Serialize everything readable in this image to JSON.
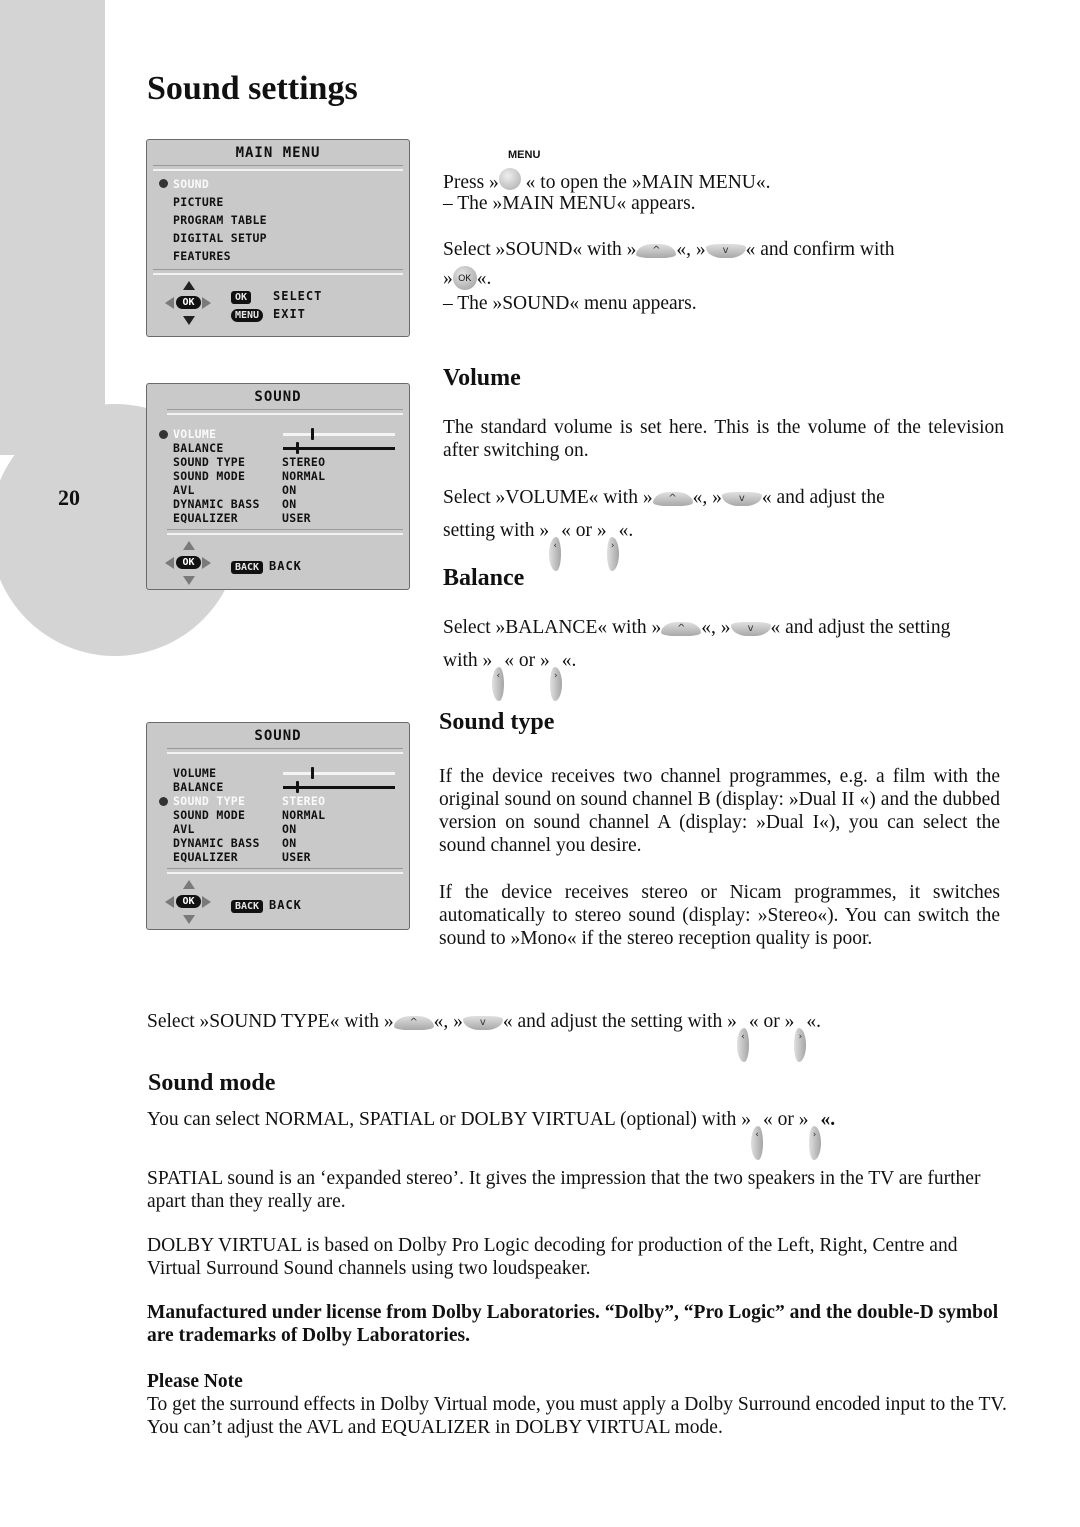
{
  "page": {
    "number": "20",
    "title": "Sound settings"
  },
  "colors": {
    "osd_background": "#c9c9c9",
    "side_decoration": "#d4d4d4",
    "selected_text": "#fafafa"
  },
  "main_menu_osd": {
    "title": "MAIN MENU",
    "items": [
      {
        "label": "SOUND",
        "selected": true
      },
      {
        "label": "PICTURE",
        "selected": false
      },
      {
        "label": "PROGRAM TABLE",
        "selected": false
      },
      {
        "label": "DIGITAL SETUP",
        "selected": false
      },
      {
        "label": "FEATURES",
        "selected": false
      }
    ],
    "ok_key": "OK",
    "select_key": "OK",
    "select_label": "SELECT",
    "menu_key": "MENU",
    "exit_label": "EXIT"
  },
  "sound_osd_1": {
    "title": "SOUND",
    "selected_row": "VOLUME",
    "rows": [
      {
        "label": "VOLUME",
        "value": "",
        "type": "slider",
        "level": 0.25
      },
      {
        "label": "BALANCE",
        "value": "",
        "type": "slider",
        "level": 0.12
      },
      {
        "label": "SOUND TYPE",
        "value": "STEREO"
      },
      {
        "label": "SOUND MODE",
        "value": "NORMAL"
      },
      {
        "label": "AVL",
        "value": "ON"
      },
      {
        "label": "DYNAMIC BASS",
        "value": "ON"
      },
      {
        "label": "EQUALIZER",
        "value": "USER"
      }
    ],
    "ok_key": "OK",
    "back_key": "BACK",
    "back_label": "BACK"
  },
  "sound_osd_2": {
    "title": "SOUND",
    "selected_row": "SOUND TYPE",
    "rows": [
      {
        "label": "VOLUME",
        "value": "",
        "type": "slider",
        "level": 0.25
      },
      {
        "label": "BALANCE",
        "value": "",
        "type": "slider",
        "level": 0.12
      },
      {
        "label": "SOUND TYPE",
        "value": "STEREO"
      },
      {
        "label": "SOUND MODE",
        "value": "NORMAL"
      },
      {
        "label": "AVL",
        "value": "ON"
      },
      {
        "label": "DYNAMIC BASS",
        "value": "ON"
      },
      {
        "label": "EQUALIZER",
        "value": "USER"
      }
    ],
    "ok_key": "OK",
    "back_key": "BACK",
    "back_label": "BACK"
  },
  "intro": {
    "menu_button_label": "MENU",
    "line1_pre": "Press »",
    "line1_post": "« to open the »MAIN MENU«.",
    "line2": "– The »MAIN MENU« appears.",
    "line3_pre": "Select »SOUND« with »",
    "sep": "«, »",
    "line3_post": "« and confirm with",
    "line4_pre": "»",
    "ok_label": "OK",
    "line4_post": "«.",
    "line5": "– The »SOUND« menu appears."
  },
  "volume": {
    "heading": "Volume",
    "body": "The standard volume is set here. This is the volume of the  television after switching on.",
    "select_pre": "Select  »VOLUME«  with »",
    "sep": "«, »",
    "select_post": "« and  adjust  the",
    "line2_pre": "setting with »",
    "or": "« or »",
    "end": "«."
  },
  "balance": {
    "heading": "Balance",
    "select_pre": "Select »BALANCE« with »",
    "sep": "«, »",
    "select_post": "« and adjust the setting",
    "line2_pre": "with »",
    "or": "« or »",
    "end": "«."
  },
  "sound_type": {
    "heading": "Sound type",
    "para1": "If the device receives two channel programmes, e.g. a film with the original sound on sound channel B (display: »Dual II «) and the dubbed version on sound channel A (display: »Dual I«), you can select the sound channel you desire.",
    "para2": "If the device receives stereo or Nicam programmes, it switches automatically to stereo sound (display: »Stereo«). You can switch the sound to »Mono« if the stereo reception quality is poor.",
    "select_pre": "Select  »SOUND TYPE«  with »",
    "sep": "«, »",
    "select_mid": "« and  adjust  the  setting with »",
    "or": "« or »",
    "end": "«."
  },
  "sound_mode": {
    "heading": "Sound mode",
    "line1_pre": "You can select NORMAL, SPATIAL or DOLBY VIRTUAL (optional) with  »",
    "or": "« or »",
    "end": "«.",
    "spatial": "SPATIAL sound is an ‘expanded stereo’.  It gives the impression that the two speakers in the TV are further apart than they really are.",
    "dolby": "DOLBY VIRTUAL is based on Dolby Pro Logic decoding for production of the Left, Right, Centre and Virtual Surround Sound channels using two loudspeaker.",
    "trademark": "Manufactured under license from Dolby Laboratories. “Dolby”, “Pro Logic” and the double-D symbol are trademarks of Dolby Laboratories.",
    "note_heading": "Please Note",
    "note_body": "To get the surround effects in Dolby Virtual  mode, you must apply a Dolby Surround encoded input to the TV. You can’t  adjust the AVL and EQUALIZER in  DOLBY VIRTUAL mode."
  },
  "icons": {
    "up": "^",
    "down": "v",
    "left": "‹",
    "right": "›"
  }
}
